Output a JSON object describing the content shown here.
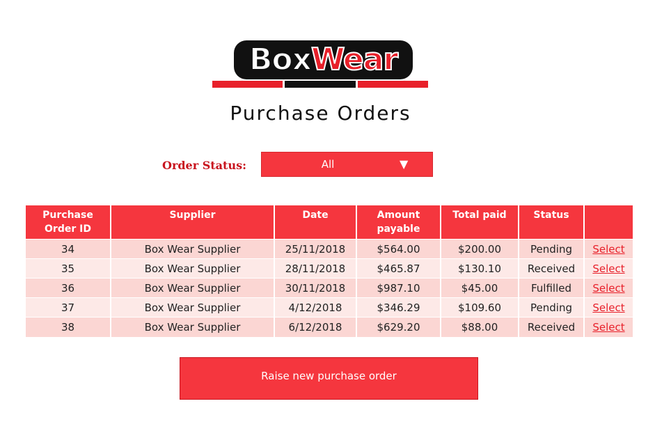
{
  "logo": {
    "part1": "Box",
    "part2": "Wear"
  },
  "page_title": "Purchase Orders",
  "filter": {
    "label": "Order Status:",
    "selected": "All",
    "arrow": "▼"
  },
  "table": {
    "headers": {
      "id_line1": "Purchase",
      "id_line2": "Order ID",
      "supplier": "Supplier",
      "date": "Date",
      "amount_line1": "Amount",
      "amount_line2": "payable",
      "total_paid": "Total paid",
      "status": "Status",
      "action": ""
    },
    "rows": [
      {
        "id": "34",
        "supplier": "Box Wear Supplier",
        "date": "25/11/2018",
        "amount": "$564.00",
        "paid": "$200.00",
        "status": "Pending",
        "action": "Select"
      },
      {
        "id": "35",
        "supplier": "Box Wear Supplier",
        "date": "28/11/2018",
        "amount": "$465.87",
        "paid": "$130.10",
        "status": "Received",
        "action": "Select"
      },
      {
        "id": "36",
        "supplier": "Box Wear Supplier",
        "date": "30/11/2018",
        "amount": "$987.10",
        "paid": "$45.00",
        "status": "Fulfilled",
        "action": "Select"
      },
      {
        "id": "37",
        "supplier": "Box Wear Supplier",
        "date": "4/12/2018",
        "amount": "$346.29",
        "paid": "$109.60",
        "status": "Pending",
        "action": "Select"
      },
      {
        "id": "38",
        "supplier": "Box Wear Supplier",
        "date": "6/12/2018",
        "amount": "$629.20",
        "paid": "$88.00",
        "status": "Received",
        "action": "Select"
      }
    ]
  },
  "raise_button": "Raise new purchase order",
  "colors": {
    "accent": "#f5363e",
    "brand_red": "#e8202a",
    "row_odd": "#fbd6d3",
    "row_even": "#fde9e7",
    "label_red": "#c8141e"
  }
}
